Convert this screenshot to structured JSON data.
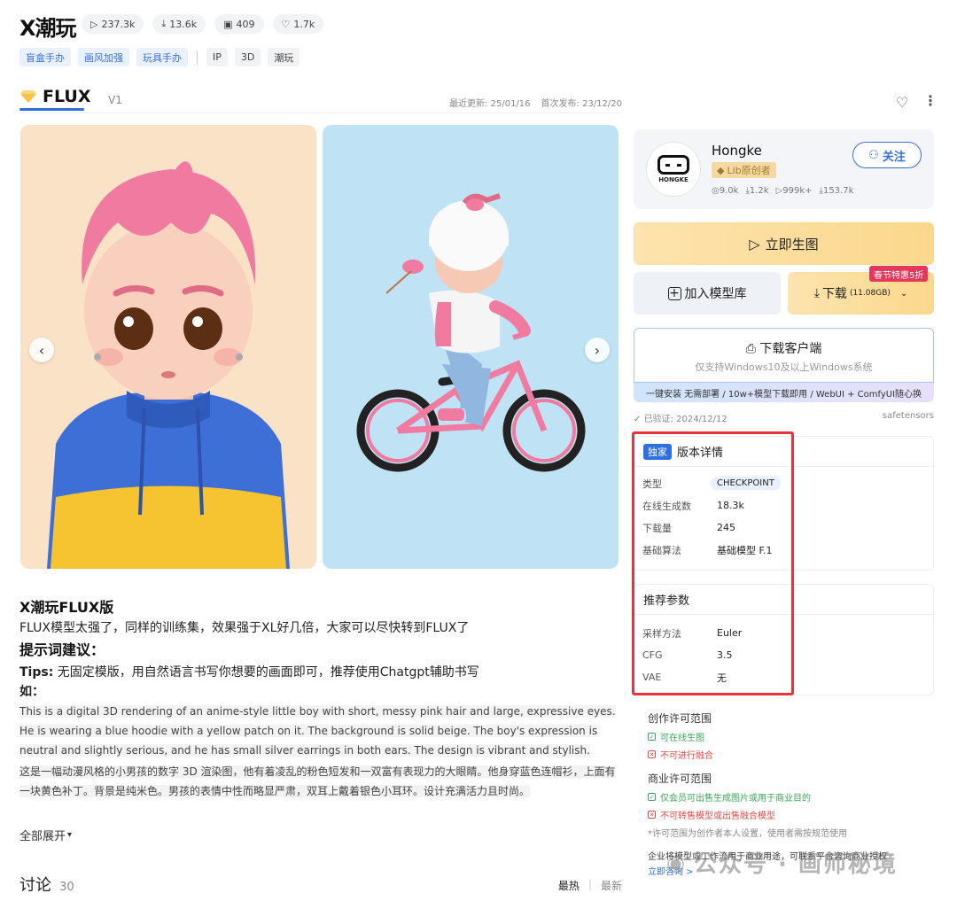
{
  "header": {
    "title": "X潮玩",
    "stats": [
      {
        "icon": "play-icon",
        "value": "237.3k"
      },
      {
        "icon": "download-icon",
        "value": "13.6k"
      },
      {
        "icon": "image-icon",
        "value": "409"
      },
      {
        "icon": "heart-icon",
        "value": "1.7k"
      }
    ],
    "tags_blue": [
      "盲盒手办",
      "画风加强",
      "玩具手办"
    ],
    "tags_gray": [
      "IP",
      "3D",
      "潮玩"
    ]
  },
  "version": {
    "tab_label": "FLUX",
    "version_label": "V1",
    "updated": "最近更新: 25/01/16",
    "published": "首次发布: 23/12/20"
  },
  "gallery": {
    "prev": "‹",
    "next": "›"
  },
  "description": {
    "heading": "X潮玩FLUX版",
    "line1": "FLUX模型太强了，同样的训练集，效果强于XL好几倍，大家可以尽快转到FLUX了",
    "prompt_heading": "提示词建议：",
    "tips_label": "Tips:",
    "tips_text": " 无固定模版，用自然语言书写你想要的画面即可，推荐使用Chatgpt辅助书写",
    "example_label": "如：",
    "example_en": "This is a digital 3D rendering of an anime-style little boy with short, messy pink hair and large, expressive eyes. He is wearing a blue hoodie with a yellow patch on it. The background is solid beige. The boy's expression is neutral and slightly serious, and he has small silver earrings in both ears. The design is vibrant and stylish.",
    "example_zh": "这是一幅动漫风格的小男孩的数字 3D 渲染图，他有着凌乱的粉色短发和一双富有表现力的大眼睛。他身穿蓝色连帽衫，上面有一块黄色补丁。背景是纯米色。男孩的表情中性而略显严肃，双耳上戴着银色小耳环。设计充满活力且时尚。",
    "expand": "全部展开"
  },
  "discussion": {
    "label": "讨论",
    "count": "30",
    "sort_hot": "最热",
    "sort_new": "最新"
  },
  "creator": {
    "name": "Hongke",
    "avatar_text": "HONGKE",
    "badge": "Lib原创者",
    "stats": [
      "9.0k",
      "1.2k",
      "999k+",
      "153.7k"
    ],
    "follow": "关注"
  },
  "actions": {
    "generate": "立即生图",
    "add_library": "加入模型库",
    "download": "下载",
    "download_size": "(11.08GB)",
    "promo": "春节特惠5折",
    "client_title": "下载客户端",
    "client_sub": "仅支持Windows10及以上Windows系统",
    "client_bar": "一键安装 无需部署 / 10w+模型下载即用 / WebUI + ComfyUI随心换",
    "verified": "已验证: 2024/12/12",
    "format": "safetensors"
  },
  "version_details": {
    "exclusive": "独家",
    "title": "版本详情",
    "rows": [
      {
        "k": "类型",
        "v": "CHECKPOINT"
      },
      {
        "k": "在线生成数",
        "v": "18.3k"
      },
      {
        "k": "下载量",
        "v": "245"
      },
      {
        "k": "基础算法",
        "v": "基础模型 F.1"
      }
    ]
  },
  "params": {
    "title": "推荐参数",
    "rows": [
      {
        "k": "采样方法",
        "v": "Euler"
      },
      {
        "k": "CFG",
        "v": "3.5"
      },
      {
        "k": "VAE",
        "v": "无"
      }
    ]
  },
  "license": {
    "creation_title": "创作许可范围",
    "creation_yes": "可在线生图",
    "creation_no": "不可进行融合",
    "commercial_title": "商业许可范围",
    "commercial_yes": "仅会员可出售生成图片或用于商业目的",
    "commercial_no": "不可转售模型或出售融合模型",
    "note": "*许可范围为创作者本人设置，使用者需按规范使用",
    "enterprise": "企业将模型或工作流用于商业用途，可联系平台咨询商业授权",
    "consult": "立即咨询 >"
  },
  "watermark": "公众号 · 画师秘境",
  "colors": {
    "accent": "#2d6ee0",
    "gold": "#fbd88c",
    "red": "#e8323c"
  }
}
